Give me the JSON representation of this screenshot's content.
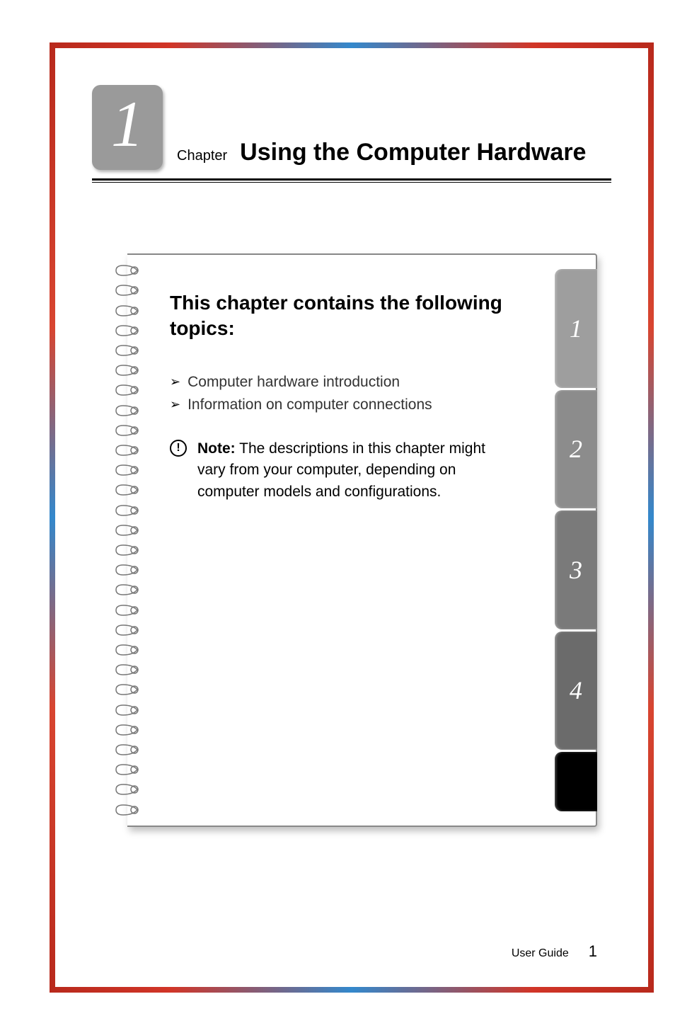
{
  "chapter": {
    "number": "1",
    "label": "Chapter",
    "title": "Using the Computer Hardware"
  },
  "section": {
    "heading": "This chapter contains the following topics:",
    "topics": [
      "Computer hardware introduction",
      "Information on computer connections"
    ],
    "note": {
      "label": "Note:",
      "text": "The descriptions in this chapter might vary from your computer, depending on computer models and configurations."
    }
  },
  "tabs": [
    "1",
    "2",
    "3",
    "4"
  ],
  "footer": {
    "label": "User Guide",
    "page": "1"
  }
}
